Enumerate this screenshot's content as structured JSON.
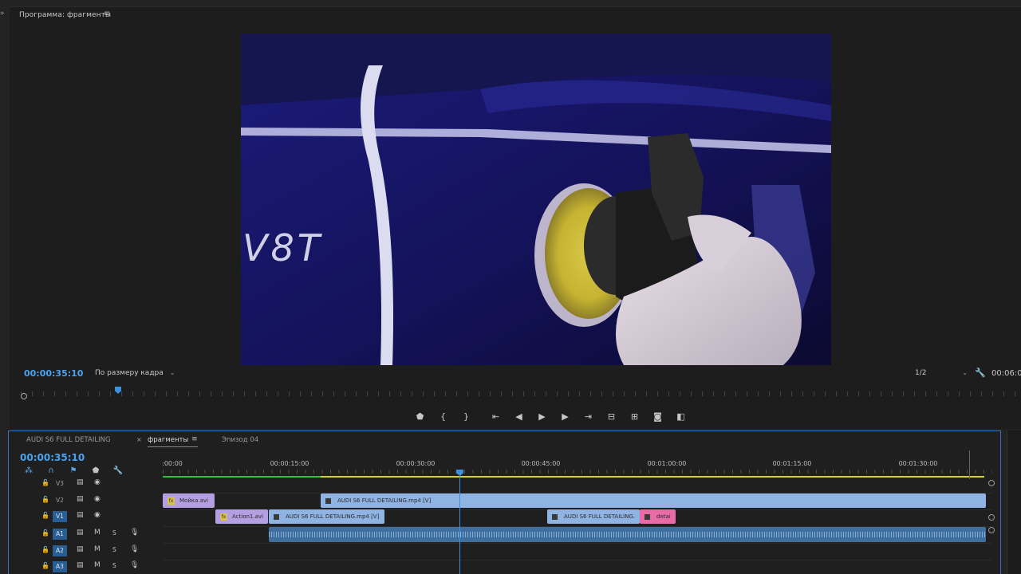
{
  "monitor": {
    "title": "Программа: фрагменты",
    "menu_icon": "≡",
    "current_timecode": "00:00:35:10",
    "fit": "По размеру кадра",
    "resolution": "1/2",
    "duration_timecode": "00:06:0"
  },
  "transport": {
    "icons": [
      "marker-icon",
      "mark-in-icon",
      "mark-out-icon",
      "go-to-in-icon",
      "step-back-icon",
      "play-icon",
      "step-forward-icon",
      "go-to-out-icon",
      "lift-icon",
      "extract-icon",
      "export-frame-icon",
      "compare-icon"
    ]
  },
  "timeline": {
    "tabs": [
      {
        "label": "AUDI S6 FULL DETAILING",
        "active": false
      },
      {
        "label": "фрагменты",
        "active": true
      },
      {
        "label": "Эпизод 04",
        "active": false
      }
    ],
    "close_glyph": "×",
    "menu_glyph": "≡",
    "current_timecode": "00:00:35:10",
    "ruler_labels": [
      ":00:00",
      "00:00:15:00",
      "00:00:30:00",
      "00:00:45:00",
      "00:01:00:00",
      "00:01:15:00",
      "00:01:30:00"
    ],
    "tracks": [
      {
        "name": "V3",
        "type": "video",
        "source": false
      },
      {
        "name": "V2",
        "type": "video",
        "source": false
      },
      {
        "name": "V1",
        "type": "video",
        "source": true
      },
      {
        "name": "A1",
        "type": "audio",
        "source": true
      },
      {
        "name": "A2",
        "type": "audio",
        "source": true
      },
      {
        "name": "A3",
        "type": "audio",
        "source": true
      }
    ],
    "audio_labels": {
      "mute": "M",
      "solo": "S"
    },
    "clips": {
      "v2_a": "Мойка.avi",
      "v2_b": "AUDI S6 FULL DETAILING.mp4 [V]",
      "v1_a": "Action1.avi",
      "v1_b": "AUDI S6 FULL DETAILING.mp4 [V]",
      "v1_c": "AUDI S6 FULL DETAILING.",
      "v1_d": "detai"
    },
    "fx_label": "fx"
  },
  "colors": {
    "accent": "#4aa3f0",
    "clip_blue": "#8fb3e2",
    "clip_purple": "#b49fe2",
    "clip_pink": "#e86aa7",
    "work_area": "#d9d022",
    "rendered": "#2fbf3a"
  }
}
